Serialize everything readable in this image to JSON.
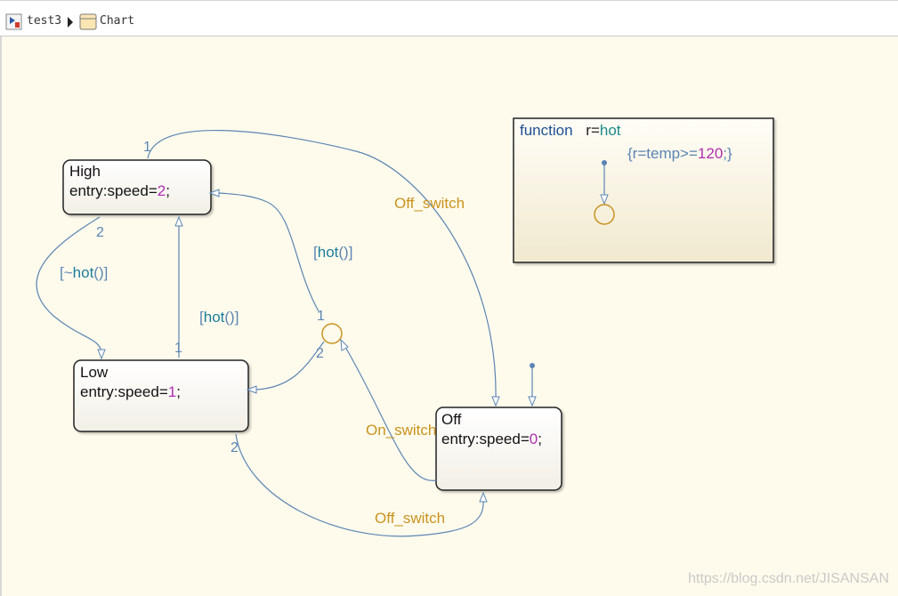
{
  "breadcrumb": {
    "model": "test3",
    "chart": "Chart"
  },
  "states": {
    "high": {
      "name": "High",
      "entry_prefix": "entry:speed=",
      "entry_value": "2",
      "entry_suffix": ";"
    },
    "low": {
      "name": "Low",
      "entry_prefix": "entry:speed=",
      "entry_value": "1",
      "entry_suffix": ";"
    },
    "off": {
      "name": "Off",
      "entry_prefix": "entry:speed=",
      "entry_value": "0",
      "entry_suffix": ";"
    }
  },
  "function_box": {
    "keyword": "function",
    "signature_prefix": "r=",
    "signature_name": "hot",
    "action_open": "{r=temp>=",
    "action_value": "120",
    "action_close": ";}"
  },
  "transitions": {
    "off_switch_top": "Off_switch",
    "off_switch_bottom": "Off_switch",
    "on_switch": "On_switch",
    "hot_guard_upper": {
      "open": "[",
      "name": "hot",
      "close": "()]"
    },
    "hot_guard_left": {
      "open": "[",
      "name": "hot",
      "close": "()]"
    },
    "not_hot_guard": {
      "open": "[~",
      "name": "hot",
      "close": "()]"
    }
  },
  "execution_order": {
    "high_top": "1",
    "high_bottom": "2",
    "low_top": "1",
    "low_bottom": "2",
    "junction_top": "1",
    "junction_bottom": "2"
  },
  "watermark": "https://blog.csdn.net/JISANSAN",
  "colors": {
    "canvas": "#fffbec",
    "transition": "#5b84b4",
    "event_label": "#c8931e",
    "guard_label": "#1b7d9c",
    "keyword": "#1e4f93",
    "number": "#b02eb0",
    "junction": "#c8931e"
  }
}
